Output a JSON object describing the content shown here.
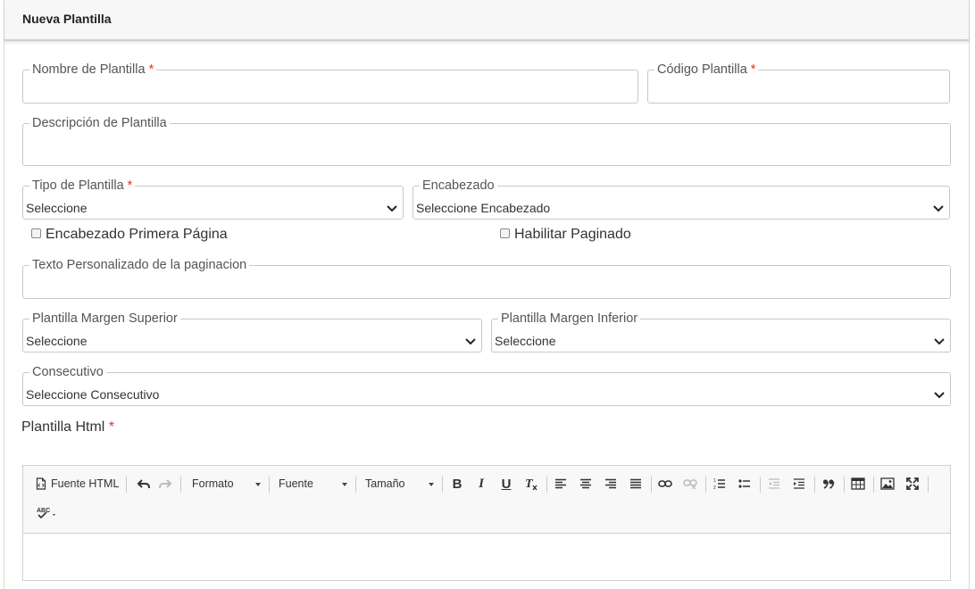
{
  "header": {
    "title": "Nueva Plantilla"
  },
  "form": {
    "nombre": {
      "label": "Nombre de Plantilla",
      "required": "*",
      "value": ""
    },
    "codigo": {
      "label": "Código Plantilla",
      "required": "*",
      "value": ""
    },
    "descripcion": {
      "label": "Descripción de Plantilla",
      "value": ""
    },
    "tipo": {
      "label": "Tipo de Plantilla",
      "required": "*",
      "selected": "Seleccione"
    },
    "encabezado": {
      "label": "Encabezado",
      "selected": "Seleccione Encabezado"
    },
    "encabezado_primera": {
      "label": "Encabezado Primera Página",
      "checked": false
    },
    "habilitar_paginado": {
      "label": "Habilitar Paginado",
      "checked": false
    },
    "texto_paginacion": {
      "label": "Texto Personalizado de la paginacion",
      "value": ""
    },
    "margen_superior": {
      "label": "Plantilla Margen Superior",
      "selected": "Seleccione"
    },
    "margen_inferior": {
      "label": "Plantilla Margen Inferior",
      "selected": "Seleccione"
    },
    "consecutivo": {
      "label": "Consecutivo",
      "selected": "Seleccione Consecutivo"
    },
    "plantilla_html": {
      "label": "Plantilla Html",
      "required": "*"
    }
  },
  "editor": {
    "source_label": "Fuente HTML",
    "formato_label": "Formato",
    "fuente_label": "Fuente",
    "tamano_label": "Tamaño"
  }
}
